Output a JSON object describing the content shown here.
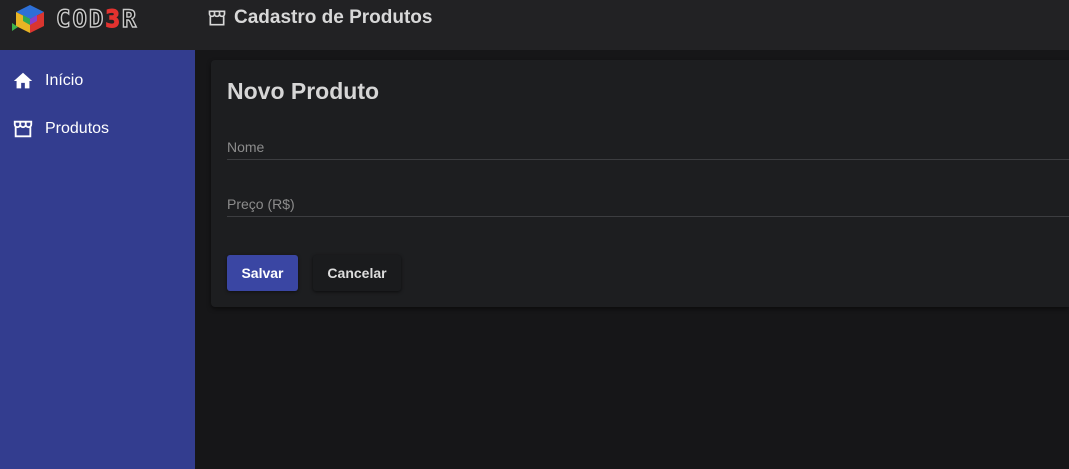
{
  "header": {
    "logo_text_prefix": "COD",
    "logo_text_accent": "3",
    "logo_text_suffix": "R",
    "title": "Cadastro de Produtos",
    "title_icon": "store-icon"
  },
  "sidebar": {
    "items": [
      {
        "label": "Início",
        "icon": "home-icon"
      },
      {
        "label": "Produtos",
        "icon": "store-icon"
      }
    ]
  },
  "form": {
    "title": "Novo Produto",
    "fields": [
      {
        "placeholder": "Nome",
        "value": ""
      },
      {
        "placeholder": "Preço (R$)",
        "value": ""
      }
    ],
    "buttons": {
      "save_label": "Salvar",
      "cancel_label": "Cancelar"
    }
  },
  "colors": {
    "topbar": "#222224",
    "sidebar": "#333d8f",
    "background": "#161618",
    "card": "#1d1e20",
    "primary_button": "#3a46a3",
    "logo_accent": "#e3322f"
  }
}
